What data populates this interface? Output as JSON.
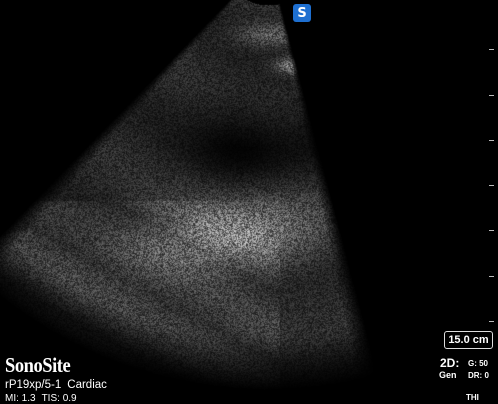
{
  "brand": "SonoSite",
  "probe": {
    "transducer": "rP19xp/5-1",
    "exam": "Cardiac"
  },
  "indices": {
    "mi": "MI: 1.3",
    "tis": "TIS: 0.9"
  },
  "depth_scale": "15.0 cm",
  "mode": {
    "label": "2D:",
    "sub": "Gen",
    "gain": "G: 50",
    "dr": "DR: 0"
  },
  "thi": "THI",
  "logo_glyph": "S",
  "icons": [
    "sonosite-logo-icon"
  ]
}
